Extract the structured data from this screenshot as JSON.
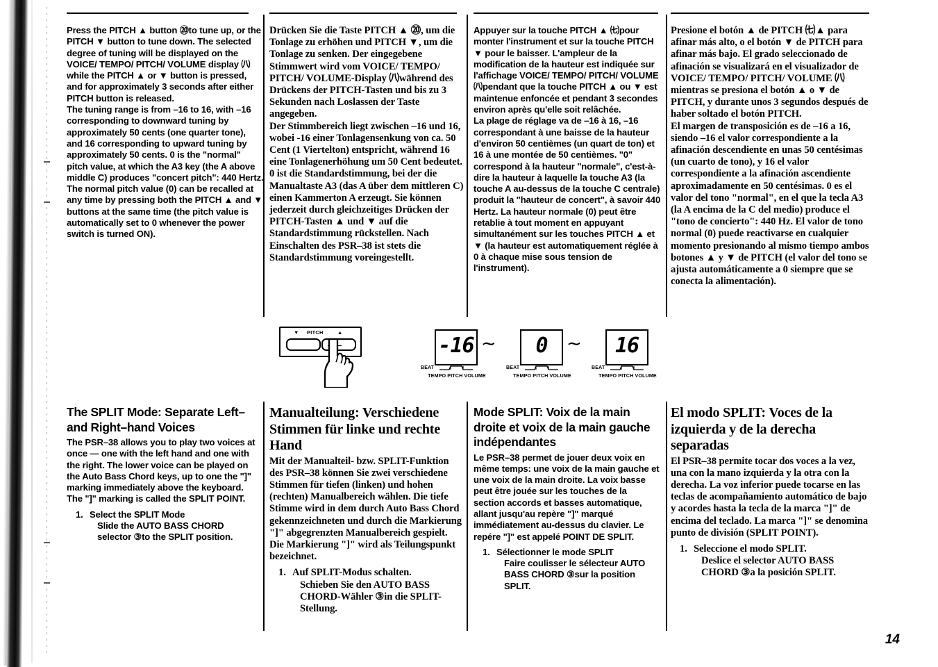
{
  "page": {
    "number": "14",
    "product": "PSR-38"
  },
  "illustration": {
    "panel": {
      "label_pitch": "PITCH",
      "label_down": "▼",
      "label_up": "▲",
      "button_down_name": "pitch-down-button",
      "button_up_name": "pitch-up-button"
    },
    "displays": [
      {
        "value": "-16",
        "beat": "BEAT",
        "sub": "TEMPO PITCH VOLUME"
      },
      {
        "value": "0",
        "beat": "BEAT",
        "sub": "TEMPO PITCH VOLUME"
      },
      {
        "value": "16",
        "beat": "BEAT",
        "sub": "TEMPO PITCH VOLUME"
      }
    ],
    "separator": "∼"
  },
  "columns": {
    "en": {
      "lang": "English",
      "top_paragraphs": [
        "Press the PITCH ▲ button ⑳to tune up, or the PITCH ▼ button to tune down. The selected degree of tuning will be displayed on the VOICE/ TEMPO/ PITCH/ VOLUME display ㈧while the PITCH ▲ or ▼ button is pressed, and for approximately 3 seconds after either PITCH button is released.",
        "The tuning range is from –16 to 16, with –16 corresponding to downward tuning by approximately 50 cents (one quarter tone), and 16 corresponding to upward tuning by approximately 50 cents. 0 is the \"normal\" pitch value, at which the A3 key (the A above middle C) produces \"concert pitch\": 440 Hertz. The normal pitch value (0) can be recalled at any time by pressing both the PITCH ▲ and ▼ buttons at the same time (the pitch value is automatically set to 0 whenever the power switch is turned ON)."
      ],
      "heading": "The SPLIT Mode: Separate Left– and Right–hand Voices",
      "body": "The PSR–38 allows you to play two voices at once — one with the left hand and one with the right. The lower voice can be played on the Auto Bass Chord keys, up to one the \"]\" marking immediately above the keyboard. The \"]\" marking is called the SPLIT POINT.",
      "step_number": "1.",
      "step_title": "Select the SPLIT Mode",
      "step_text": "Slide the AUTO BASS CHORD selector ③to the SPLIT position."
    },
    "de": {
      "lang": "Deutsch",
      "top_paragraphs": [
        "Drücken Sie die Taste PITCH ▲ ⑳, um die Tonlage zu erhöhen und PITCH ▼, um die Tonlage zu senken. Der eingegebene Stimmwert wird vom VOICE/ TEMPO/ PITCH/ VOLUME-Display ㈧während des Drückens der PITCH-Tasten und bis zu 3 Sekunden nach Loslassen der Taste angegeben.",
        "Der Stimmbereich liegt zwischen –16 und 16, wobei -16 einer Tonlagensenkung von ca. 50 Cent (1 Viertelton) entspricht, während 16 eine Tonlagenerhöhung um 50 Cent bedeutet. 0 ist die Standardstimmung, bei der die Manualtaste A3 (das A über dem mittleren C) einen Kammerton A erzeugt. Sie können jederzeit durch gleichzeitiges Drücken der PITCH-Tasten ▲ und ▼ auf die Standardstimmung rückstellen. Nach Einschalten des PSR–38 ist stets die Standardstimmung voreingestellt."
      ],
      "heading": "Manualteilung: Verschiedene Stimmen für linke und rechte Hand",
      "body": "Mit der Manualteil- bzw. SPLIT-Funktion des PSR–38 können Sie zwei verschiedene Stimmen für tiefen (linken) und hohen (rechten) Manualbereich wählen. Die tiefe Stimme wird in dem durch Auto Bass Chord gekennzeichneten und durch die Markierung \"]\" abgegrenzten Manualbereich gespielt. Die Markierung \"]\" wird als Teilungspunkt bezeichnet.",
      "step_number": "1.",
      "step_title": "Auf SPLIT-Modus schalten.",
      "step_text": "Schieben Sie den AUTO BASS CHORD-Wähler ③in die SPLIT-Stellung."
    },
    "fr": {
      "lang": "Français",
      "top_paragraphs": [
        "Appuyer sur la touche PITCH ▲ ㈦pour monter l'instrument et sur la touche PITCH ▼ pour le baisser. L'ampleur de la modification de la hauteur est indiquée sur l'affichage VOICE/ TEMPO/ PITCH/ VOLUME ㈧pendant que la touche PITCH ▲ ou ▼ est maintenue enfoncée et pendant 3 secondes environ après qu'elle soit relâchée.",
        "La plage de réglage va de –16 à 16, –16 correspondant à une baisse de la hauteur d'environ 50 centièmes (un quart de ton) et 16 à une montée de 50 centièmes. \"0\" correspond à la hauteur \"normale\", c'est-à-dire la hauteur à laquelle la touche A3 (la touche A au-dessus de la touche C centrale) produit la \"hauteur de concert\", à savoir 440 Hertz. La hauteur normale (0) peut être retablie à tout moment en appuyant simultanément sur les touches PITCH ▲ et ▼ (la hauteur est automatiquement réglée à 0 à chaque mise sous tension de l'instrument)."
      ],
      "heading": "Mode SPLIT: Voix de la main droite et voix de la main gauche indépendantes",
      "body": "Le PSR–38 permet de jouer deux voix en même temps: une voix de la main gauche et une voix de la main droite. La voix basse peut être jouée sur les touches de la section accords et basses automatique, allant jusqu'au repère \"]\" marqué immédiatement au-dessus du clavier. Le repére \"]\" est appelé POINT DE SPLIT.",
      "step_number": "1.",
      "step_title": "Sélectionner le mode SPLIT",
      "step_text": "Faire coulisser le sélecteur AUTO BASS CHORD ③sur la position SPLIT."
    },
    "es": {
      "lang": "Español",
      "top_paragraphs": [
        "Presione el botón ▲ de PITCH ㈦▲ para afinar más alto, o el botón ▼ de PITCH para afinar más bajo. El grado seleccionado de afinación se visualizará en el visualizador de VOICE/ TEMPO/ PITCH/ VOLUME ㈧mientras se presiona el botón ▲ o ▼ de PITCH, y durante unos 3 segundos después de haber soltado el botón PITCH.",
        "El margen de transposición es de –16 a 16, siendo –16 el valor correspondiente a la afinación descendiente en unas 50 centésimas (un cuarto de tono), y 16 el valor correspondiente a la afinación ascendiente aproximadamente en 50 centésimas. 0 es el valor del tono \"normal\", en el que la tecla A3 (la A encima de la C del medio) produce el \"tono de concierto\": 440 Hz. El valor de tono normal (0) puede reactivarse en cualquier momento presionando al mismo tiempo ambos botones ▲ y ▼ de PITCH (el valor del tono se ajusta automáticamente a 0 siempre que se conecta la alimentación)."
      ],
      "heading": "El modo SPLIT:  Voces de la izquierda y de la derecha separadas",
      "body": "El PSR–38 permite tocar dos voces a la vez, una con la mano izquierda y la otra con la derecha. La voz inferior puede tocarse en las teclas de acompañamiento automático de bajo y acordes hasta la tecla de la marca \"]\" de encima del teclado. La marca \"]\" se denomina punto de división (SPLIT POINT).",
      "step_number": "1.",
      "step_title": "Seleccione el modo SPLIT.",
      "step_text": "Deslice el selector AUTO BASS CHORD ③a la posición SPLIT."
    }
  }
}
